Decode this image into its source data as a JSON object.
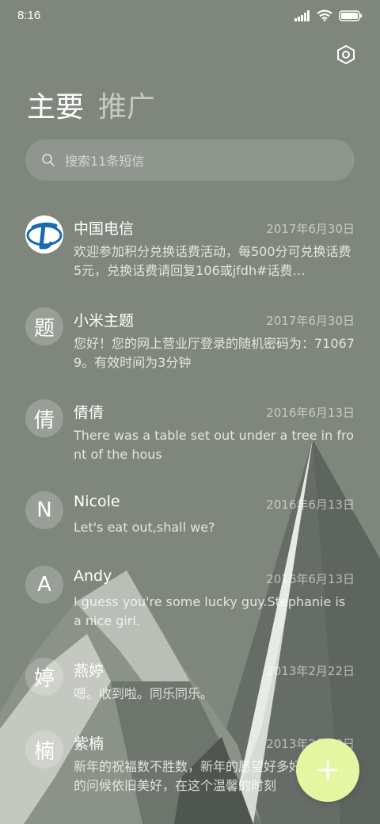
{
  "status": {
    "time": "8:16"
  },
  "tabs": [
    {
      "label": "主要",
      "active": true
    },
    {
      "label": "推广",
      "active": false
    }
  ],
  "search": {
    "placeholder": "搜索11条短信"
  },
  "messages": [
    {
      "avatar": "",
      "avatar_type": "china-telecom-logo",
      "name": "中国电信",
      "date": "2017年6月30日",
      "snippet": "欢迎参加积分兑换话费活动，每500分可兑换话费5元，兑换话费请回复106或jfdh#话费…"
    },
    {
      "avatar": "题",
      "name": "小米主题",
      "date": "2017年6月30日",
      "snippet": "您好！您的网上营业厅登录的随机密码为：710679。有效时间为3分钟"
    },
    {
      "avatar": "倩",
      "name": "倩倩",
      "date": "2016年6月13日",
      "snippet": "There was a table set out under a tree in front of the hous"
    },
    {
      "avatar": "N",
      "name": "Nicole",
      "date": "2016年6月13日",
      "snippet": "Let's eat out,shall we?"
    },
    {
      "avatar": "A",
      "name": "Andy",
      "date": "2016年6月13日",
      "snippet": "I guess you're some lucky guy.Stephanie is a nice girl."
    },
    {
      "avatar": "婷",
      "name": "燕婷",
      "date": "2013年2月22日",
      "snippet": "嗯。收到啦。同乐同乐。"
    },
    {
      "avatar": "楠",
      "name": "紫楠",
      "date": "2013年2月20日",
      "snippet": "新年的祝福数不胜数，新年的愿望好多好多，新年的问候依旧美好，在这个温馨的时刻"
    }
  ],
  "colors": {
    "background": "#7f877d",
    "fab": "#e4f6a2",
    "text": "#ffffff"
  },
  "icons": {
    "settings": "hexagon-settings-icon",
    "search": "search-icon",
    "fab": "plus-icon"
  }
}
